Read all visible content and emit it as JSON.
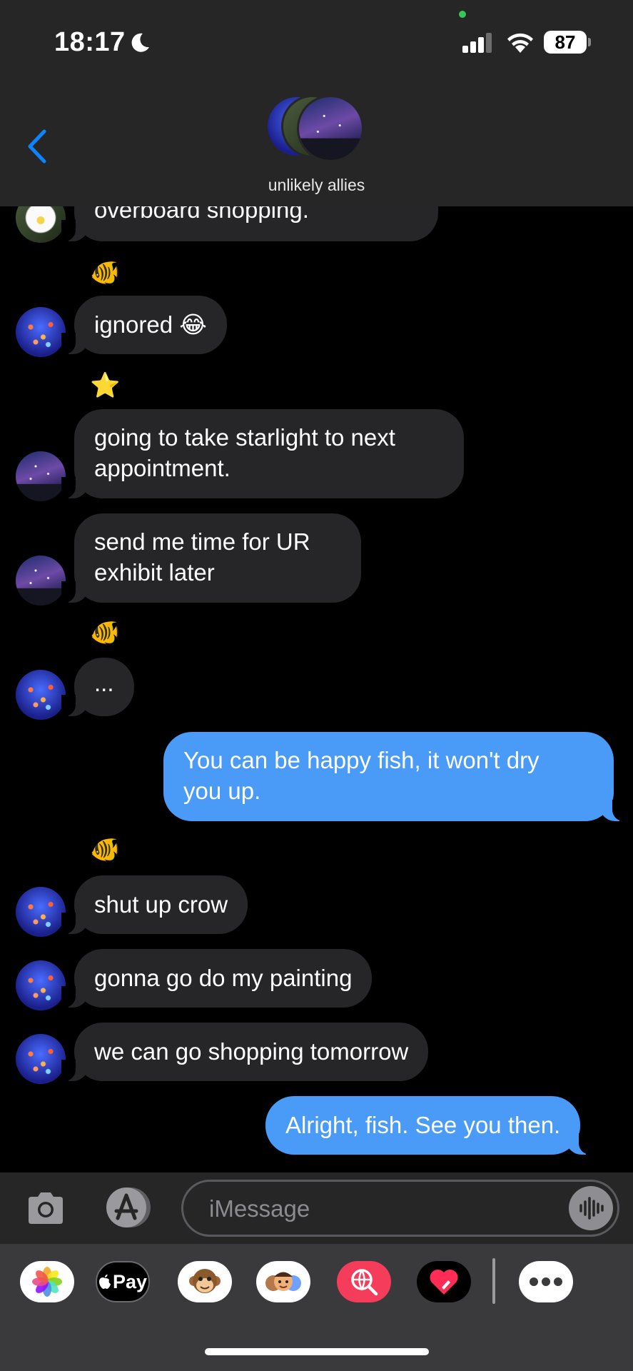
{
  "status_bar": {
    "time": "18:17",
    "battery": "87"
  },
  "header": {
    "group_name": "unlikely allies"
  },
  "messages": [
    {
      "text": "overboard shopping."
    },
    {
      "tapback": "🐠"
    },
    {
      "text": "ignored 😂"
    },
    {
      "tapback": "⭐"
    },
    {
      "line1": "going to take starlight to next",
      "line2": "appointment."
    },
    {
      "line1": "send me time for UR",
      "line2": "exhibit later"
    },
    {
      "tapback": "🐠"
    },
    {
      "text": "..."
    },
    {
      "line1": "You can be happy fish, it won't dry",
      "line2": "you up."
    },
    {
      "tapback": "🐠"
    },
    {
      "text": "shut up crow"
    },
    {
      "text": "gonna go do my painting"
    },
    {
      "text": "we can go shopping tomorrow"
    },
    {
      "text": "Alright, fish. See you then."
    }
  ],
  "composer": {
    "placeholder": "iMessage"
  },
  "app_drawer": {
    "apple_pay_label": "Pay"
  },
  "colors": {
    "outgoing_bubble": "#4a9af8",
    "incoming_bubble": "#262629",
    "accent": "#0a84ff"
  }
}
